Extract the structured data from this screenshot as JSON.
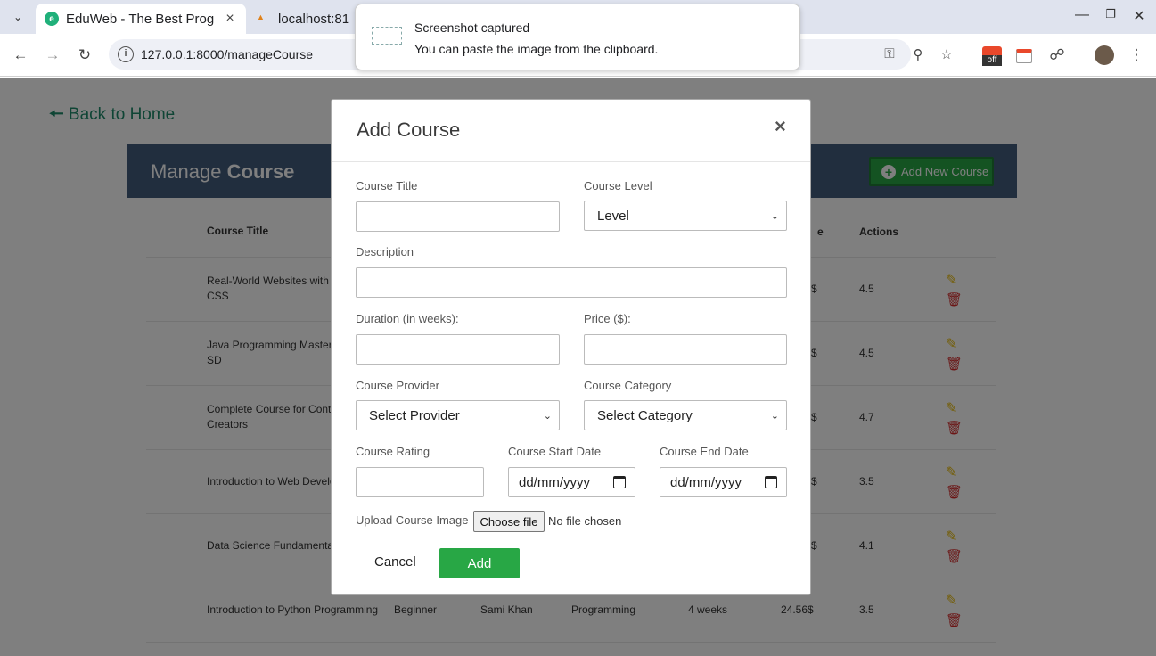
{
  "browser": {
    "tabs": [
      {
        "title": "EduWeb - The Best Prog",
        "active": true
      },
      {
        "title": "localhost:81",
        "active": false
      }
    ],
    "url": "127.0.0.1:8000/manageCourse",
    "ext_off_label": "off"
  },
  "toast": {
    "title": "Screenshot captured",
    "message": "You can paste the image from the clipboard."
  },
  "page": {
    "back_link": "Back to Home",
    "title_light": "Manage ",
    "title_bold": "Course",
    "add_button": "Add New Course"
  },
  "table": {
    "headers": [
      "Course Title",
      "",
      "",
      "",
      "",
      "e",
      "Actions"
    ],
    "rows": [
      {
        "title": "Real-World Websites with HTML and CSS",
        "level": "",
        "provider": "",
        "category": "",
        "duration": "",
        "price": "$",
        "rating": "4.5"
      },
      {
        "title": "Java Programming Masterclass for SD",
        "level": "",
        "provider": "",
        "category": "",
        "duration": "",
        "price": "$",
        "rating": "4.5"
      },
      {
        "title": "Complete Course for Content Creators",
        "level": "",
        "provider": "",
        "category": "",
        "duration": "",
        "price": "$",
        "rating": "4.7"
      },
      {
        "title": "Introduction to Web Development",
        "level": "",
        "provider": "",
        "category": "",
        "duration": "",
        "price": "$",
        "rating": "3.5"
      },
      {
        "title": "Data Science Fundamentals",
        "level": "",
        "provider": "",
        "category": "",
        "duration": "",
        "price": "$",
        "rating": "4.1"
      },
      {
        "title": "Introduction to Python Programming",
        "level": "Beginner",
        "provider": "Sami Khan",
        "category": "Programming",
        "duration": "4 weeks",
        "price": "24.56$",
        "rating": "3.5"
      }
    ]
  },
  "modal": {
    "title": "Add Course",
    "close": "×",
    "labels": {
      "course_title": "Course Title",
      "course_level": "Course Level",
      "description": "Description",
      "duration": "Duration (in weeks):",
      "price": "Price ($):",
      "provider": "Course Provider",
      "category": "Course Category",
      "rating": "Course Rating",
      "start_date": "Course Start Date",
      "end_date": "Course End Date",
      "upload": "Upload Course Image"
    },
    "values": {
      "level_selected": "Level",
      "provider_selected": "Select Provider",
      "category_selected": "Select Category",
      "date_placeholder": "dd/mm/yyyy"
    },
    "file_button": "Choose file",
    "file_status": "No file chosen",
    "cancel": "Cancel",
    "submit": "Add"
  },
  "colors": {
    "header_bg": "#435d7d",
    "accent_green": "#28a745",
    "link_teal": "#1e8a6a"
  }
}
